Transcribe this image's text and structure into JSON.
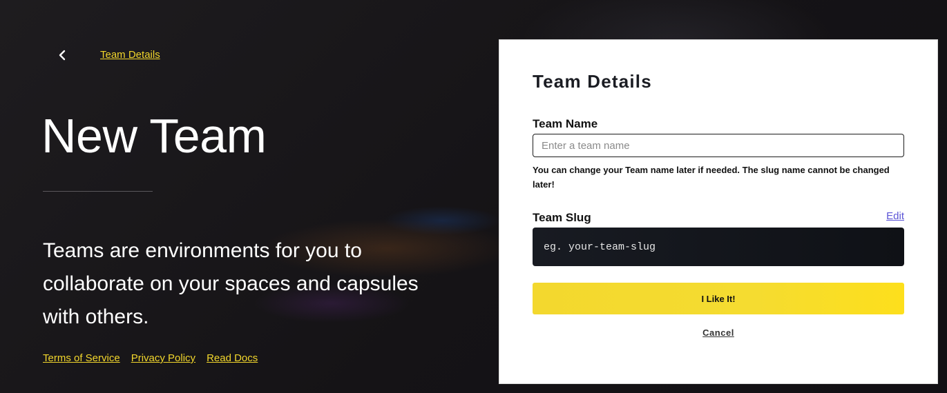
{
  "breadcrumb": {
    "back_icon": "chevron-left-icon",
    "label": "Team Details"
  },
  "hero": {
    "title": "New Team",
    "description": "Teams are environments for you to collaborate on your spaces and capsules with others."
  },
  "footer_links": [
    {
      "label": "Terms of Service"
    },
    {
      "label": "Privacy Policy"
    },
    {
      "label": "Read Docs"
    }
  ],
  "form": {
    "title": "Team Details",
    "team_name": {
      "label": "Team Name",
      "placeholder": "Enter a team name",
      "value": "",
      "help": "You can change your Team name later if needed. The slug name cannot be changed later!"
    },
    "team_slug": {
      "label": "Team Slug",
      "edit_label": "Edit",
      "value": "eg. your-team-slug"
    },
    "submit_label": "I Like It!",
    "cancel_label": "Cancel"
  },
  "colors": {
    "accent_yellow": "#f3d72c",
    "edit_link": "#5b54d6",
    "slug_bg": "#13161c",
    "page_bg": "#181619"
  }
}
